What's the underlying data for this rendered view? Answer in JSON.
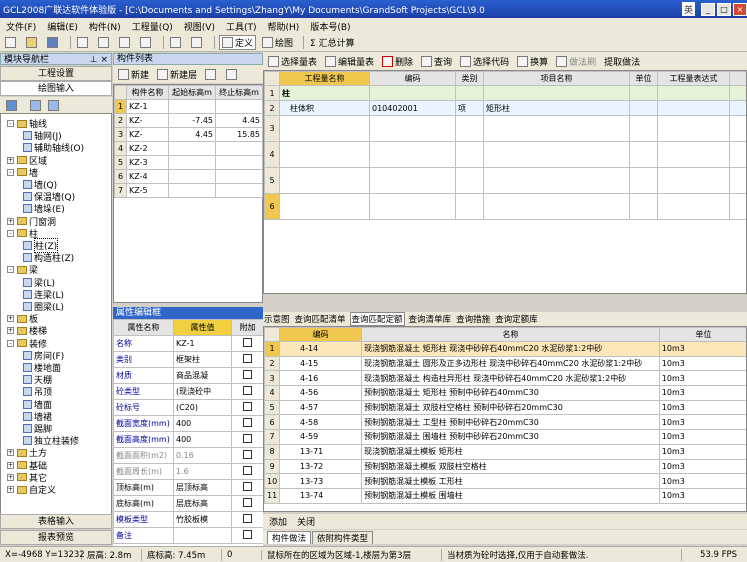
{
  "window": {
    "title": "GCL2008广联达软件体验版 - [C:\\Documents and Settings\\ZhangY\\My Documents\\GrandSoft Projects\\GCL\\9.0",
    "ime": "英"
  },
  "menu": [
    "文件(F)",
    "编辑(E)",
    "构件(N)",
    "工程量(Q)",
    "视图(V)",
    "工具(T)",
    "帮助(H)",
    "版本号(B)"
  ],
  "toolbar": {
    "define": "定义",
    "draw": "绘图",
    "sum": "Σ 汇总计算"
  },
  "nav": {
    "title": "模块导航栏",
    "project_settings": "工程设置",
    "drawing_input": "绘图输入",
    "table_input": "表格输入",
    "report_preview": "报表预览"
  },
  "tree": [
    {
      "label": "轴线",
      "level": 0,
      "exp": "-"
    },
    {
      "label": "轴网(J)",
      "level": 1
    },
    {
      "label": "辅助轴线(O)",
      "level": 1
    },
    {
      "label": "区域",
      "level": 0,
      "exp": "+"
    },
    {
      "label": "墙",
      "level": 0,
      "exp": "-"
    },
    {
      "label": "墙(Q)",
      "level": 1
    },
    {
      "label": "保温墙(Q)",
      "level": 1
    },
    {
      "label": "墙垛(E)",
      "level": 1
    },
    {
      "label": "门窗洞",
      "level": 0,
      "exp": "+"
    },
    {
      "label": "柱",
      "level": 0,
      "exp": "-"
    },
    {
      "label": "柱(Z)",
      "level": 1
    },
    {
      "label": "构造柱(Z)",
      "level": 1
    },
    {
      "label": "梁",
      "level": 0,
      "exp": "-"
    },
    {
      "label": "梁(L)",
      "level": 1
    },
    {
      "label": "连梁(L)",
      "level": 1
    },
    {
      "label": "圈梁(L)",
      "level": 1
    },
    {
      "label": "板",
      "level": 0,
      "exp": "+"
    },
    {
      "label": "楼梯",
      "level": 0,
      "exp": "+"
    },
    {
      "label": "装修",
      "level": 0,
      "exp": "-"
    },
    {
      "label": "房间(F)",
      "level": 1
    },
    {
      "label": "楼地面",
      "level": 1
    },
    {
      "label": "天棚",
      "level": 1
    },
    {
      "label": "吊顶",
      "level": 1
    },
    {
      "label": "墙面",
      "level": 1
    },
    {
      "label": "墙裙",
      "level": 1
    },
    {
      "label": "踢脚",
      "level": 1
    },
    {
      "label": "独立柱装修",
      "level": 1
    },
    {
      "label": "土方",
      "level": 0,
      "exp": "+"
    },
    {
      "label": "基础",
      "level": 0,
      "exp": "+"
    },
    {
      "label": "其它",
      "level": 0,
      "exp": "+"
    },
    {
      "label": "自定义",
      "level": 0,
      "exp": "+"
    }
  ],
  "component_list": {
    "title": "构件列表",
    "new": "新建",
    "new_layer": "新建层",
    "headers": [
      "构件名称",
      "起始标高m",
      "终止标高m"
    ],
    "rows": [
      {
        "n": "1",
        "name": "KZ-1",
        "start": "",
        "end": ""
      },
      {
        "n": "2",
        "name": "KZ-",
        "start": "-7.45",
        "end": "4.45"
      },
      {
        "n": "3",
        "name": "KZ-",
        "start": "4.45",
        "end": "15.85"
      },
      {
        "n": "4",
        "name": "KZ-2",
        "start": "",
        "end": ""
      },
      {
        "n": "5",
        "name": "KZ-3",
        "start": "",
        "end": ""
      },
      {
        "n": "6",
        "name": "KZ-4",
        "start": "",
        "end": ""
      },
      {
        "n": "7",
        "name": "KZ-5",
        "start": "",
        "end": ""
      }
    ]
  },
  "properties": {
    "title": "属性编辑框",
    "headers": [
      "属性名称",
      "属性值",
      "附加"
    ],
    "rows": [
      {
        "name": "名称",
        "value": "KZ-1",
        "style": "blue"
      },
      {
        "name": "类别",
        "value": "框架柱",
        "style": "blue"
      },
      {
        "name": "材质",
        "value": "商品混凝",
        "style": "blue"
      },
      {
        "name": "砼类型",
        "value": "(现浇砼中",
        "style": "blue"
      },
      {
        "name": "砼标号",
        "value": "(C20)",
        "style": "blue"
      },
      {
        "name": "截面宽度(mm)",
        "value": "400",
        "style": "blue"
      },
      {
        "name": "截面高度(mm)",
        "value": "400",
        "style": "blue"
      },
      {
        "name": "截面面积(m2)",
        "value": "0.16",
        "style": "gray"
      },
      {
        "name": "截面周长(m)",
        "value": "1.6",
        "style": "gray"
      },
      {
        "name": "顶标高(m)",
        "value": "层顶标高",
        "style": ""
      },
      {
        "name": "底标高(m)",
        "value": "层底标高",
        "style": ""
      },
      {
        "name": "模板类型",
        "value": "竹胶板模",
        "style": "blue"
      },
      {
        "name": "备注",
        "value": "",
        "style": "blue"
      }
    ]
  },
  "main_toolbar": [
    "选择量表",
    "编辑量表",
    "删除",
    "查询",
    "选择代码",
    "换算",
    "做法刷",
    "提取做法"
  ],
  "main_grid": {
    "headers": [
      "工程量名称",
      "编码",
      "类别",
      "项目名称",
      "单位",
      "工程量表达式",
      "表"
    ],
    "rows": [
      {
        "n": "1",
        "name": "柱",
        "code": "",
        "cat": "",
        "item": "",
        "unit": ""
      },
      {
        "n": "2",
        "name": "柱体积",
        "code": "010402001",
        "cat": "项",
        "item": "矩形柱",
        "unit": ""
      },
      {
        "n": "3",
        "name": "",
        "code": "",
        "cat": "",
        "item": "",
        "unit": ""
      },
      {
        "n": "4",
        "name": "",
        "code": "",
        "cat": "",
        "item": "",
        "unit": ""
      },
      {
        "n": "5",
        "name": "",
        "code": "",
        "cat": "",
        "item": "",
        "unit": ""
      },
      {
        "n": "6",
        "name": "",
        "code": "",
        "cat": "",
        "item": "",
        "unit": ""
      }
    ]
  },
  "query_tabs": [
    "示意图",
    "查询匹配清单",
    "查询匹配定额",
    "查询清单库",
    "查询措施",
    "查询定额库"
  ],
  "query_grid": {
    "headers": [
      "编码",
      "名称",
      "单位"
    ],
    "rows": [
      {
        "n": "1",
        "code": "4-14",
        "name": "现浇钢筋混凝土 矩形柱 现浇中砂碎石40mmC20 水泥砂浆1:2中砂",
        "unit": "10m3"
      },
      {
        "n": "2",
        "code": "4-15",
        "name": "现浇钢筋混凝土 圆形及正多边形柱 现浇中砂碎石40mmC20 水泥砂浆1:2中砂",
        "unit": "10m3"
      },
      {
        "n": "3",
        "code": "4-16",
        "name": "现浇钢筋混凝土 构造柱异形柱 现浇中砂碎石40mmC20 水泥砂浆1:2中砂",
        "unit": "10m3"
      },
      {
        "n": "4",
        "code": "4-56",
        "name": "预制钢筋混凝土 矩形柱 预制中砂碎石40mmC30",
        "unit": "10m3"
      },
      {
        "n": "5",
        "code": "4-57",
        "name": "预制钢筋混凝土 双肢柱空格柱 预制中砂碎石20mmC30",
        "unit": "10m3"
      },
      {
        "n": "6",
        "code": "4-58",
        "name": "预制钢筋混凝土 工型柱 预制中砂碎石20mmC30",
        "unit": "10m3"
      },
      {
        "n": "7",
        "code": "4-59",
        "name": "预制钢筋混凝土 围墙柱 预制中砂碎石20mmC30",
        "unit": "10m3"
      },
      {
        "n": "8",
        "code": "13-71",
        "name": "现浇钢筋混凝土模板 矩形柱",
        "unit": "10m3"
      },
      {
        "n": "9",
        "code": "13-72",
        "name": "预制钢筋混凝土模板 双肢柱空格柱",
        "unit": "10m3"
      },
      {
        "n": "10",
        "code": "13-73",
        "name": "预制钢筋混凝土模板 工形柱",
        "unit": "10m3"
      },
      {
        "n": "11",
        "code": "13-74",
        "name": "预制钢筋混凝土模板 围墙柱",
        "unit": "10m3"
      }
    ]
  },
  "query_buttons": [
    "添加",
    "关闭"
  ],
  "bottom_tabs": [
    "构件做法",
    "依附构件类型"
  ],
  "status": {
    "coords": "X=-4968 Y=13232",
    "floor_height": "层高: 2.8m",
    "base_height": "底标高: 7.45m",
    "zero": "0",
    "hint": "鼠标所在的区域为区域-1,楼层为第3层",
    "tip": "当材质为砼时选择,仅用于自动套做法.",
    "fps": "53.9 FPS"
  }
}
